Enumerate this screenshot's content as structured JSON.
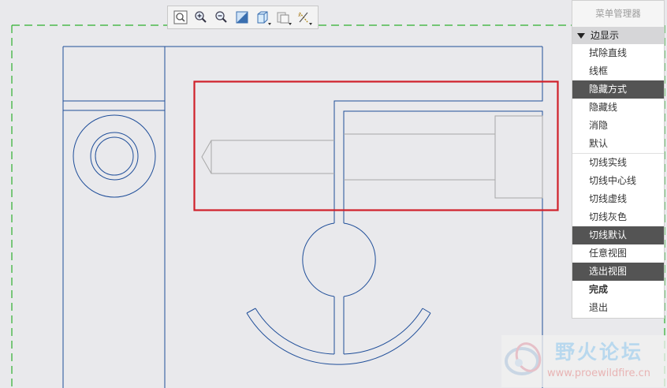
{
  "toolbar": {
    "buttons": [
      {
        "name": "zoom-refit-icon",
        "dropdown": false
      },
      {
        "name": "zoom-in-icon",
        "dropdown": false
      },
      {
        "name": "zoom-out-icon",
        "dropdown": false
      },
      {
        "name": "repaint-icon",
        "dropdown": false
      },
      {
        "name": "display-style-icon",
        "dropdown": true
      },
      {
        "name": "saved-views-icon",
        "dropdown": true
      },
      {
        "name": "datum-display-icon",
        "dropdown": true
      }
    ]
  },
  "menu": {
    "title": "菜单管理器",
    "section": "边显示",
    "items": [
      {
        "label": "拭除直线",
        "state": "normal"
      },
      {
        "label": "线框",
        "state": "normal"
      },
      {
        "label": "隐藏方式",
        "state": "selected"
      },
      {
        "label": "隐藏线",
        "state": "normal"
      },
      {
        "label": "消隐",
        "state": "normal"
      },
      {
        "label": "默认",
        "state": "normal"
      },
      {
        "label": "切线实线",
        "state": "normal"
      },
      {
        "label": "切线中心线",
        "state": "normal"
      },
      {
        "label": "切线虚线",
        "state": "normal"
      },
      {
        "label": "切线灰色",
        "state": "normal"
      },
      {
        "label": "切线默认",
        "state": "selected"
      },
      {
        "label": "任意视图",
        "state": "normal"
      },
      {
        "label": "选出视图",
        "state": "selected"
      },
      {
        "label": "完成",
        "state": "bold"
      },
      {
        "label": "退出",
        "state": "normal"
      }
    ]
  },
  "colors": {
    "drawing_line": "#1f4e99",
    "hidden_line": "#a8a8a8",
    "highlight_box": "#d0202a",
    "sheet_border": "#2db02d",
    "selected_bg": "#545454"
  },
  "watermark": {
    "title": "野火论坛",
    "url": "www.proewildfire.cn"
  }
}
